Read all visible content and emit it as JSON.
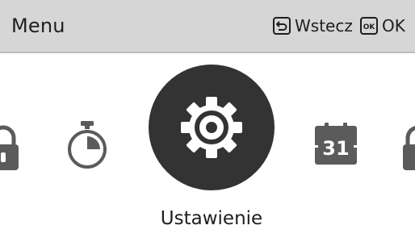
{
  "header": {
    "title": "Menu",
    "back_label": "Wstecz",
    "ok_label": "OK",
    "ok_key_glyph": "OK"
  },
  "menu": {
    "items": [
      {
        "icon": "lock-icon"
      },
      {
        "icon": "timer-icon"
      },
      {
        "icon": "gear-icon",
        "label": "Ustawienie",
        "selected": true
      },
      {
        "icon": "calendar-icon",
        "glyph": "31"
      },
      {
        "icon": "lock-icon"
      }
    ],
    "selected_label": "Ustawienie"
  },
  "colors": {
    "header_bg": "#d6d6d6",
    "selected_circle": "#333333",
    "icon": "#5b5b5b",
    "text": "#1e1e1e"
  }
}
